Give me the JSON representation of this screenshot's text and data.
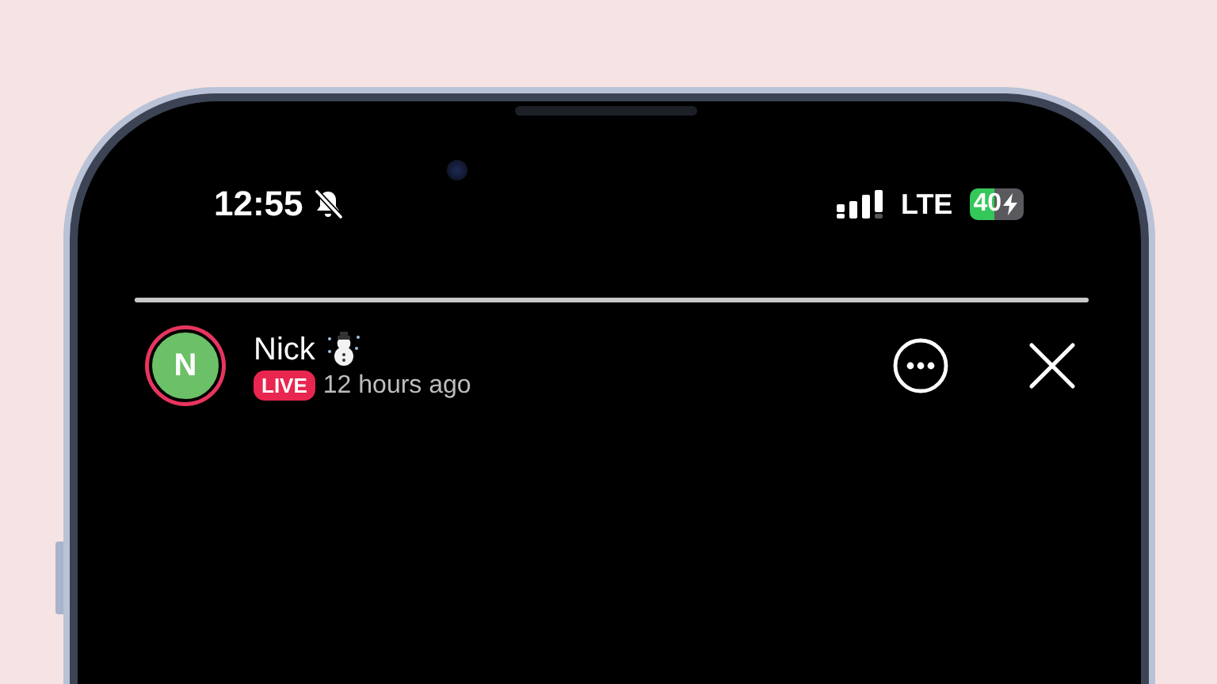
{
  "status_bar": {
    "time": "12:55",
    "silent": true,
    "network": "LTE",
    "battery": "40",
    "charging": true
  },
  "story": {
    "progress": {
      "level": 1
    },
    "user": {
      "initial": "N",
      "name": "Nick",
      "live_badge": "LIVE",
      "time_ago": "12 hours ago"
    }
  }
}
